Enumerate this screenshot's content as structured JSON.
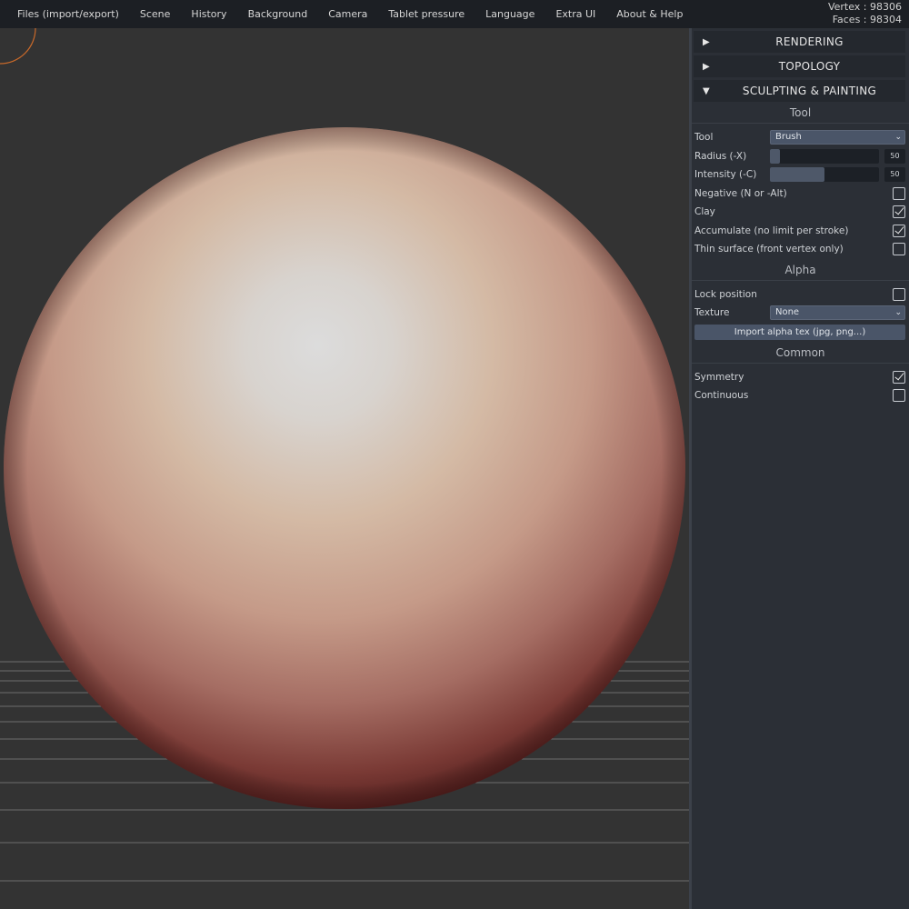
{
  "menubar": {
    "items": [
      "Files (import/export)",
      "Scene",
      "History",
      "Background",
      "Camera",
      "Tablet pressure",
      "Language",
      "Extra UI",
      "About & Help"
    ],
    "vertex_label": "Vertex : 98306",
    "faces_label": "Faces : 98304"
  },
  "panel": {
    "folders": {
      "rendering": {
        "arrow": "▶",
        "title": "RENDERING"
      },
      "topology": {
        "arrow": "▶",
        "title": "TOPOLOGY"
      },
      "sculpting": {
        "arrow": "▼",
        "title": "SCULPTING & PAINTING"
      }
    },
    "tool_section": {
      "title": "Tool",
      "tool_label": "Tool",
      "tool_value": "Brush",
      "radius_label": "Radius (-X)",
      "radius_value": "50",
      "radius_fill": 0.09,
      "intensity_label": "Intensity (-C)",
      "intensity_value": "50",
      "intensity_fill": 0.5,
      "negative_label": "Negative (N or -Alt)",
      "negative_checked": false,
      "clay_label": "Clay",
      "clay_checked": true,
      "accumulate_label": "Accumulate (no limit per stroke)",
      "accumulate_checked": true,
      "thin_label": "Thin surface (front vertex only)",
      "thin_checked": false
    },
    "alpha_section": {
      "title": "Alpha",
      "lock_label": "Lock position",
      "lock_checked": false,
      "texture_label": "Texture",
      "texture_value": "None",
      "import_button": "Import alpha tex (jpg, png...)"
    },
    "common_section": {
      "title": "Common",
      "symmetry_label": "Symmetry",
      "symmetry_checked": true,
      "continuous_label": "Continuous",
      "continuous_checked": false
    }
  },
  "colors": {
    "menubar_bg": "#1c1f24",
    "viewport_bg": "#333333",
    "panel_bg": "#2b2f36",
    "brush_cursor": "#c8692a",
    "sphere_highlight": "#d8d8d8",
    "sphere_base": "#c9a18c",
    "sphere_shadow": "#3a0f10"
  }
}
